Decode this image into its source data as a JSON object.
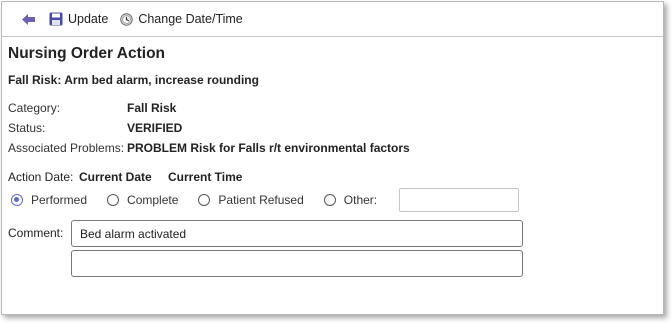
{
  "toolbar": {
    "back_icon": "back-arrow-icon",
    "update_label": "Update",
    "update_icon": "save-disk-icon",
    "change_label": "Change Date/Time",
    "change_icon": "clock-icon",
    "accent": "#6b5fb8"
  },
  "form": {
    "title": "Nursing Order Action",
    "subtitle": "Fall Risk: Arm bed alarm, increase rounding",
    "fields": [
      {
        "label": "Category:",
        "value": "Fall Risk"
      },
      {
        "label": "Status:",
        "value": "VERIFIED"
      },
      {
        "label": "Associated Problems:",
        "value": "PROBLEM Risk for Falls r/t environmental factors"
      }
    ],
    "action_date_label": "Action Date:",
    "current_date": "Current Date",
    "current_time": "Current Time",
    "radio_options": [
      "Performed",
      "Complete",
      "Patient Refused",
      "Other:"
    ],
    "radio_selected": "Performed",
    "other_value": "",
    "comment_label": "Comment:",
    "comment_line1": "Bed alarm activated",
    "comment_line2": "",
    "radio_color": "#5c6bd6"
  }
}
